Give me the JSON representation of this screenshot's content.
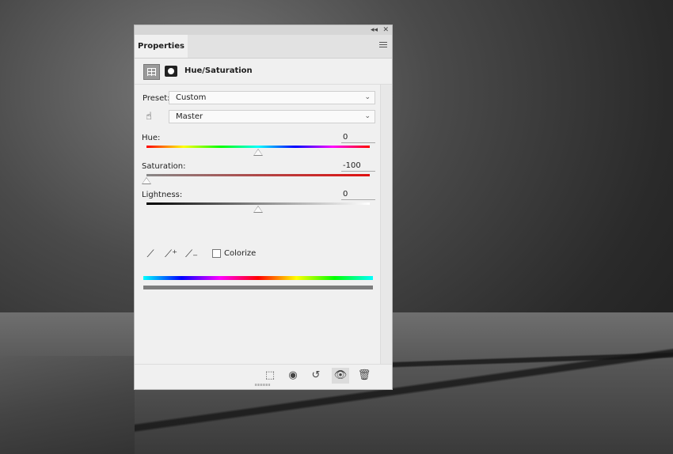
{
  "panel": {
    "tab_label": "Properties",
    "collapse_icon": "double-chevron-left-icon",
    "close_icon": "close-icon",
    "menu_icon": "panel-menu-icon",
    "adjustment_title": "Hue/Saturation"
  },
  "preset": {
    "label": "Preset:",
    "value": "Custom"
  },
  "channel": {
    "value": "Master"
  },
  "hue": {
    "label": "Hue:",
    "value": "0",
    "slider_fraction": 0.5
  },
  "saturation": {
    "label": "Saturation:",
    "value": "-100",
    "slider_fraction": 0.0
  },
  "lightness": {
    "label": "Lightness:",
    "value": "0",
    "slider_fraction": 0.5
  },
  "colorize": {
    "label": "Colorize",
    "checked": false
  },
  "bottom_tools": [
    "clip-to-layer-icon",
    "view-previous-state-icon",
    "reset-icon",
    "toggle-visibility-icon",
    "delete-icon"
  ]
}
